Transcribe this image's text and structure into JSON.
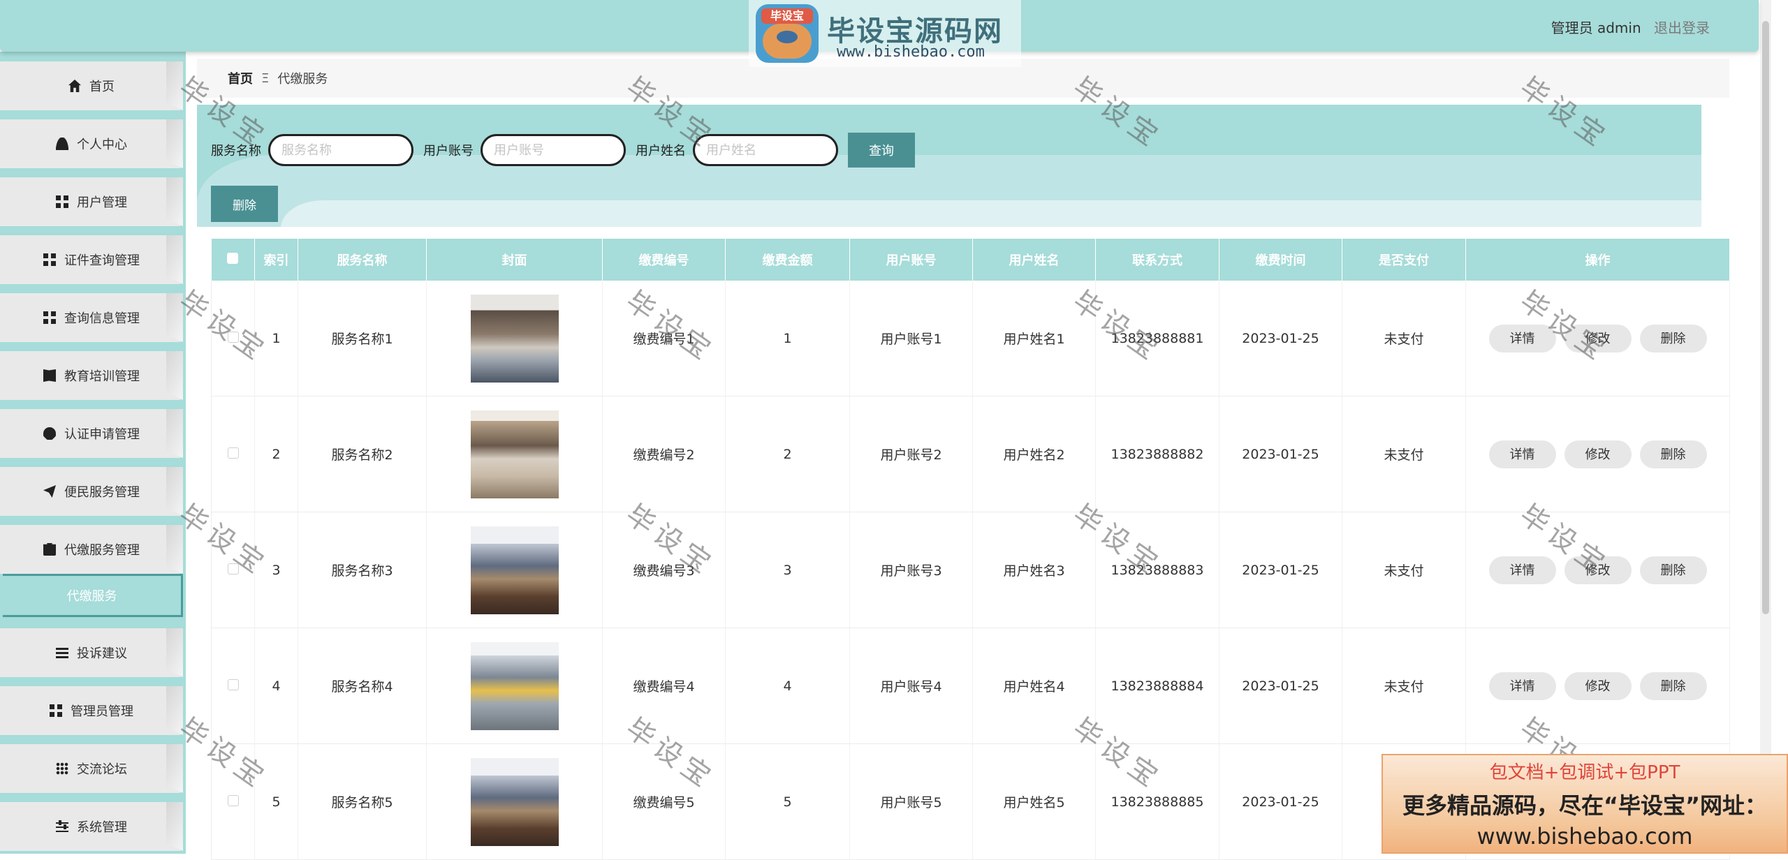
{
  "header": {
    "logo_badge": "毕设宝",
    "logo_text": "毕设宝源码网",
    "logo_url": "www.bishebao.com",
    "user_label": "管理员 admin",
    "logout_label": "退出登录"
  },
  "sidebar": {
    "items": [
      {
        "label": "首页",
        "icon": "home-icon"
      },
      {
        "label": "个人中心",
        "icon": "user-icon"
      },
      {
        "label": "用户管理",
        "icon": "grid-icon"
      },
      {
        "label": "证件查询管理",
        "icon": "grid-icon"
      },
      {
        "label": "查询信息管理",
        "icon": "grid-icon"
      },
      {
        "label": "教育培训管理",
        "icon": "book-icon"
      },
      {
        "label": "认证申请管理",
        "icon": "bulb-icon"
      },
      {
        "label": "便民服务管理",
        "icon": "plane-icon"
      },
      {
        "label": "代缴服务管理",
        "icon": "clipboard-icon"
      },
      {
        "label": "代缴服务",
        "icon": ""
      },
      {
        "label": "投诉建议",
        "icon": "list-icon"
      },
      {
        "label": "管理员管理",
        "icon": "grid-icon"
      },
      {
        "label": "交流论坛",
        "icon": "dots-grid-icon"
      },
      {
        "label": "系统管理",
        "icon": "slider-icon"
      }
    ]
  },
  "breadcrumb": {
    "home": "首页",
    "separator": "Ξ",
    "current": "代缴服务"
  },
  "search": {
    "service_name_label": "服务名称",
    "service_name_placeholder": "服务名称",
    "user_account_label": "用户账号",
    "user_account_placeholder": "用户账号",
    "user_name_label": "用户姓名",
    "user_name_placeholder": "用户姓名",
    "query_label": "查询",
    "delete_label": "删除"
  },
  "table": {
    "headers": [
      "索引",
      "服务名称",
      "封面",
      "缴费编号",
      "缴费金额",
      "用户账号",
      "用户姓名",
      "联系方式",
      "缴费时间",
      "是否支付",
      "操作"
    ],
    "actions": {
      "detail": "详情",
      "edit": "修改",
      "delete": "删除"
    },
    "rows": [
      {
        "index": "1",
        "service_name": "服务名称1",
        "fee_no": "缴费编号1",
        "amount": "1",
        "account": "用户账号1",
        "name": "用户姓名1",
        "phone": "13823888881",
        "time": "2023-01-25",
        "paid": "未支付"
      },
      {
        "index": "2",
        "service_name": "服务名称2",
        "fee_no": "缴费编号2",
        "amount": "2",
        "account": "用户账号2",
        "name": "用户姓名2",
        "phone": "13823888882",
        "time": "2023-01-25",
        "paid": "未支付"
      },
      {
        "index": "3",
        "service_name": "服务名称3",
        "fee_no": "缴费编号3",
        "amount": "3",
        "account": "用户账号3",
        "name": "用户姓名3",
        "phone": "13823888883",
        "time": "2023-01-25",
        "paid": "未支付"
      },
      {
        "index": "4",
        "service_name": "服务名称4",
        "fee_no": "缴费编号4",
        "amount": "4",
        "account": "用户账号4",
        "name": "用户姓名4",
        "phone": "13823888884",
        "time": "2023-01-25",
        "paid": "未支付"
      },
      {
        "index": "5",
        "service_name": "服务名称5",
        "fee_no": "缴费编号5",
        "amount": "5",
        "account": "用户账号5",
        "name": "用户姓名5",
        "phone": "13823888885",
        "time": "2023-01-25",
        "paid": ""
      }
    ]
  },
  "watermark": "毕设宝",
  "ad": {
    "line1": "包文档+包调试+包PPT",
    "line2": "更多精品源码，尽在“毕设宝”网址：",
    "line3": "www.bishebao.com"
  },
  "colors": {
    "theme": "#a6dcd9",
    "button": "#4a9093"
  }
}
